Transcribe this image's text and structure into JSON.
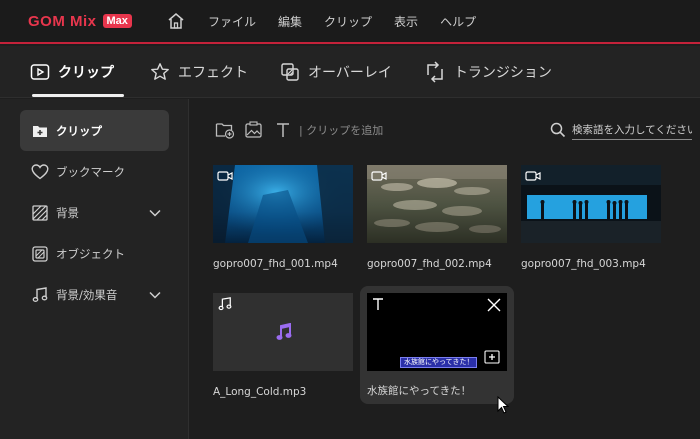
{
  "app": {
    "logo_text": "GOM Mix",
    "logo_badge": "Max",
    "brand_color": "#e8364d"
  },
  "menu": [
    "ファイル",
    "編集",
    "クリップ",
    "表示",
    "ヘルプ"
  ],
  "tabs": [
    {
      "label": "クリップ",
      "icon": "clip-icon",
      "active": true
    },
    {
      "label": "エフェクト",
      "icon": "star-icon",
      "active": false
    },
    {
      "label": "オーバーレイ",
      "icon": "overlay-icon",
      "active": false
    },
    {
      "label": "トランジション",
      "icon": "transition-icon",
      "active": false
    }
  ],
  "sidebar": {
    "items": [
      {
        "label": "クリップ",
        "icon": "folder-add-icon",
        "active": true
      },
      {
        "label": "ブックマーク",
        "icon": "heart-icon"
      },
      {
        "label": "背景",
        "icon": "background-icon",
        "expandable": true
      },
      {
        "label": "オブジェクト",
        "icon": "object-icon"
      },
      {
        "label": "背景/効果音",
        "icon": "music-icon",
        "expandable": true
      }
    ]
  },
  "toolbar": {
    "add_text": "| クリップを追加"
  },
  "search": {
    "placeholder": "検索語を入力してください。"
  },
  "clips": [
    {
      "label": "gopro007_fhd_001.mp4",
      "type": "video"
    },
    {
      "label": "gopro007_fhd_002.mp4",
      "type": "video"
    },
    {
      "label": "gopro007_fhd_003.mp4",
      "type": "video"
    },
    {
      "label": "A_Long_Cold.mp3",
      "type": "audio"
    },
    {
      "label": "水族館にやってきた！",
      "type": "text",
      "caption": "水族館にやってきた！"
    }
  ]
}
